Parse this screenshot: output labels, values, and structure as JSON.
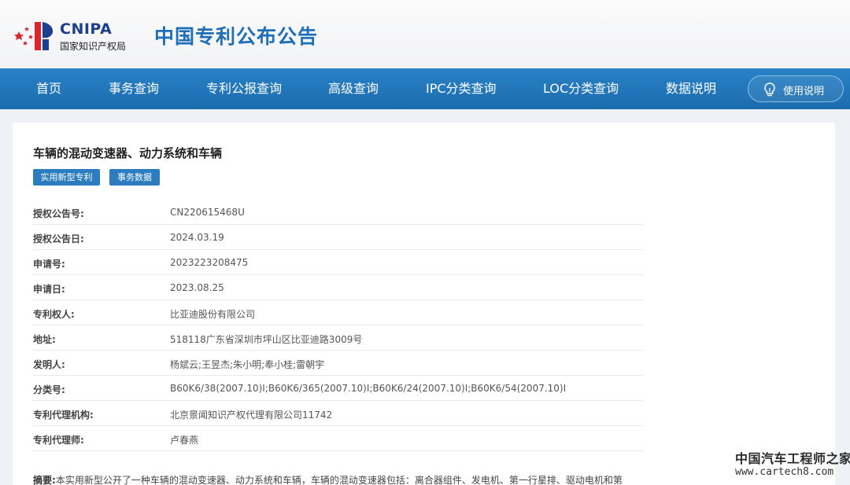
{
  "header": {
    "logo_en": "CNIPA",
    "logo_cn": "国家知识产权局",
    "site_title": "中国专利公布公告"
  },
  "nav": {
    "items": [
      "首页",
      "事务查询",
      "专利公报查询",
      "高级查询",
      "IPC分类查询",
      "LOC分类查询",
      "数据说明"
    ],
    "help_label": "使用说明",
    "help_icon": "lightbulb-icon"
  },
  "patent": {
    "title": "车辆的混动变速器、动力系统和车辆",
    "tags": [
      "实用新型专利",
      "事务数据"
    ],
    "fields": [
      {
        "label": "授权公告号:",
        "value": "CN220615468U"
      },
      {
        "label": "授权公告日:",
        "value": "2024.03.19"
      },
      {
        "label": "申请号:",
        "value": "2023223208475"
      },
      {
        "label": "申请日:",
        "value": "2023.08.25"
      },
      {
        "label": "专利权人:",
        "value": "比亚迪股份有限公司"
      },
      {
        "label": "地址:",
        "value": "518118广东省深圳市坪山区比亚迪路3009号"
      },
      {
        "label": "发明人:",
        "value": "杨斌云;王昱杰;朱小明;奉小桂;雷朝宇"
      },
      {
        "label": "分类号:",
        "value": "B60K6/38(2007.10)I;B60K6/365(2007.10)I;B60K6/24(2007.10)I;B60K6/54(2007.10)I"
      },
      {
        "label": "专利代理机构:",
        "value": "北京景闻知识产权代理有限公司11742"
      },
      {
        "label": "专利代理师:",
        "value": "卢春燕"
      }
    ],
    "abstract_label": "摘要:",
    "abstract_text": "本实用新型公开了一种车辆的混动变速器、动力系统和车辆，车辆的混动变速器包括：离合器组件、发电机、第一行星排、驱动电机和第"
  },
  "watermark": {
    "cn": "中国汽车工程师之家",
    "url": "www.cartech8.com"
  },
  "colors": {
    "nav_bg": "#1b6cae",
    "title_blue": "#1f6fb8",
    "tag_bg": "#2b7dc0"
  }
}
